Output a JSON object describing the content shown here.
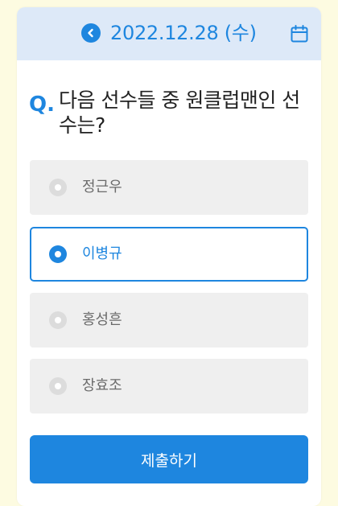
{
  "header": {
    "date": "2022.12.28 (수)",
    "back_icon": "chevron-left-circle-icon",
    "calendar_icon": "calendar-icon"
  },
  "question": {
    "marker": "Q.",
    "text": "다음 선수들 중 원클럽맨인 선수는?"
  },
  "options": [
    {
      "label": "정근우",
      "selected": false
    },
    {
      "label": "이병규",
      "selected": true
    },
    {
      "label": "홍성흔",
      "selected": false
    },
    {
      "label": "장효조",
      "selected": false
    }
  ],
  "submit": {
    "label": "제출하기"
  },
  "colors": {
    "accent": "#1e86df",
    "header_bg": "#dde9f8",
    "page_bg": "#fdfbe1",
    "option_bg": "#efefef"
  }
}
